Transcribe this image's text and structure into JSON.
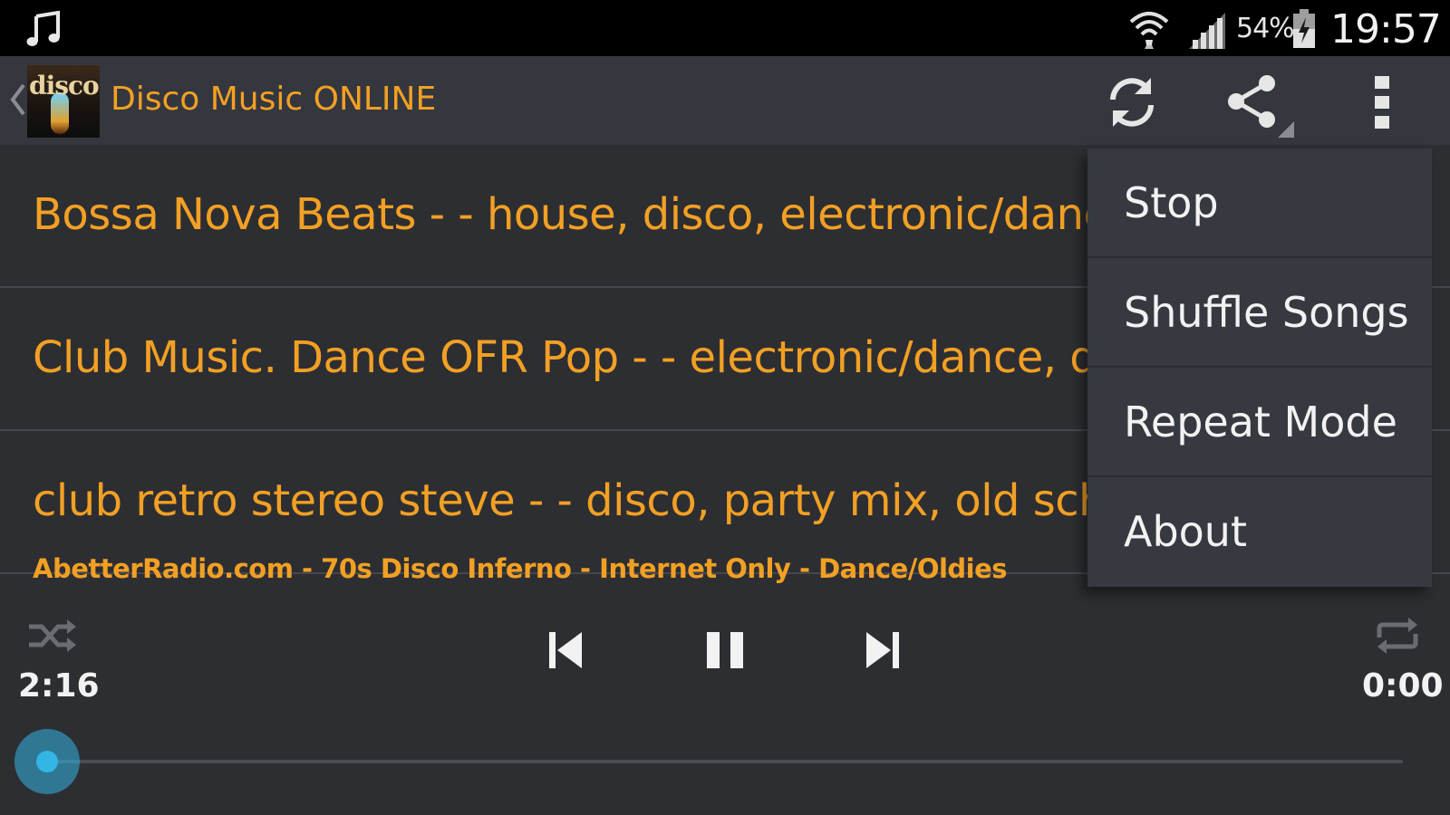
{
  "status_bar": {
    "battery_percent": "54%",
    "clock": "19:57",
    "icons": [
      "music-note-icon",
      "wifi-icon",
      "cell-signal-icon",
      "battery-charging-icon"
    ]
  },
  "action_bar": {
    "title": "Disco Music ONLINE",
    "logo_text": "disco",
    "icons": [
      "back-chevron-icon",
      "refresh-icon",
      "share-icon",
      "overflow-menu-icon"
    ]
  },
  "tracks": [
    {
      "text": "Bossa Nova Beats - - house, disco, electronic/dance"
    },
    {
      "text": "Club Music. Dance OFR Pop - - electronic/dance, disco"
    },
    {
      "text": "club retro stereo steve - - disco, party mix, old school"
    }
  ],
  "now_playing": "AbetterRadio.com - 70s Disco Inferno - Internet Only - Dance/Oldies",
  "player": {
    "elapsed": "2:16",
    "total": "0:00",
    "progress": 0.0,
    "icons": [
      "shuffle-icon",
      "previous-icon",
      "pause-icon",
      "next-icon",
      "repeat-icon"
    ]
  },
  "menu": {
    "items": [
      {
        "label": "Stop"
      },
      {
        "label": "Shuffle Songs"
      },
      {
        "label": "Repeat Mode"
      },
      {
        "label": "About"
      }
    ]
  },
  "colors": {
    "accent": "#f2a024",
    "seek": "#33b5e5",
    "background": "#2d2e32",
    "action_bar": "#35373e",
    "menu": "#363940"
  }
}
